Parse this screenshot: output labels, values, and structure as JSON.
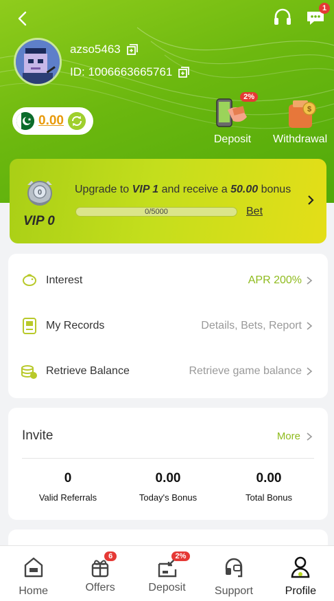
{
  "header": {
    "username": "azso5463",
    "user_id": "ID: 1006663665761",
    "balance": "0.00",
    "notification_count": "1"
  },
  "actions": [
    {
      "label": "Deposit",
      "badge": "2%"
    },
    {
      "label": "Withdrawal"
    }
  ],
  "vip": {
    "level": "VIP 0",
    "upgrade_prefix": "Upgrade to ",
    "next_level": "VIP 1",
    "upgrade_mid": " and receive a ",
    "bonus": "50.00",
    "upgrade_suffix": " bonus",
    "progress_text": "0/5000",
    "progress_fraction": 0,
    "bet_label": "Bet"
  },
  "menu": [
    {
      "label": "Interest",
      "value": "APR 200%",
      "icon": "piggy-bank-icon"
    },
    {
      "label": "My Records",
      "value": "Details, Bets, Report",
      "icon": "records-icon"
    },
    {
      "label": "Retrieve Balance",
      "value": "Retrieve game balance",
      "icon": "coins-icon"
    }
  ],
  "invite": {
    "title": "Invite",
    "more_label": "More",
    "stats": [
      {
        "value": "0",
        "label": "Valid Referrals"
      },
      {
        "value": "0.00",
        "label": "Today's Bonus"
      },
      {
        "value": "0.00",
        "label": "Total Bonus"
      }
    ]
  },
  "nav": [
    {
      "label": "Home",
      "icon": "home-icon"
    },
    {
      "label": "Offers",
      "icon": "gift-icon",
      "badge": "6"
    },
    {
      "label": "Deposit",
      "icon": "deposit-icon",
      "badge": "2%"
    },
    {
      "label": "Support",
      "icon": "support-icon"
    },
    {
      "label": "Profile",
      "icon": "profile-icon",
      "active": true
    }
  ],
  "colors": {
    "brand_green": "#8fbb1e",
    "badge_red": "#e53935",
    "balance_orange": "#e89a0c"
  }
}
